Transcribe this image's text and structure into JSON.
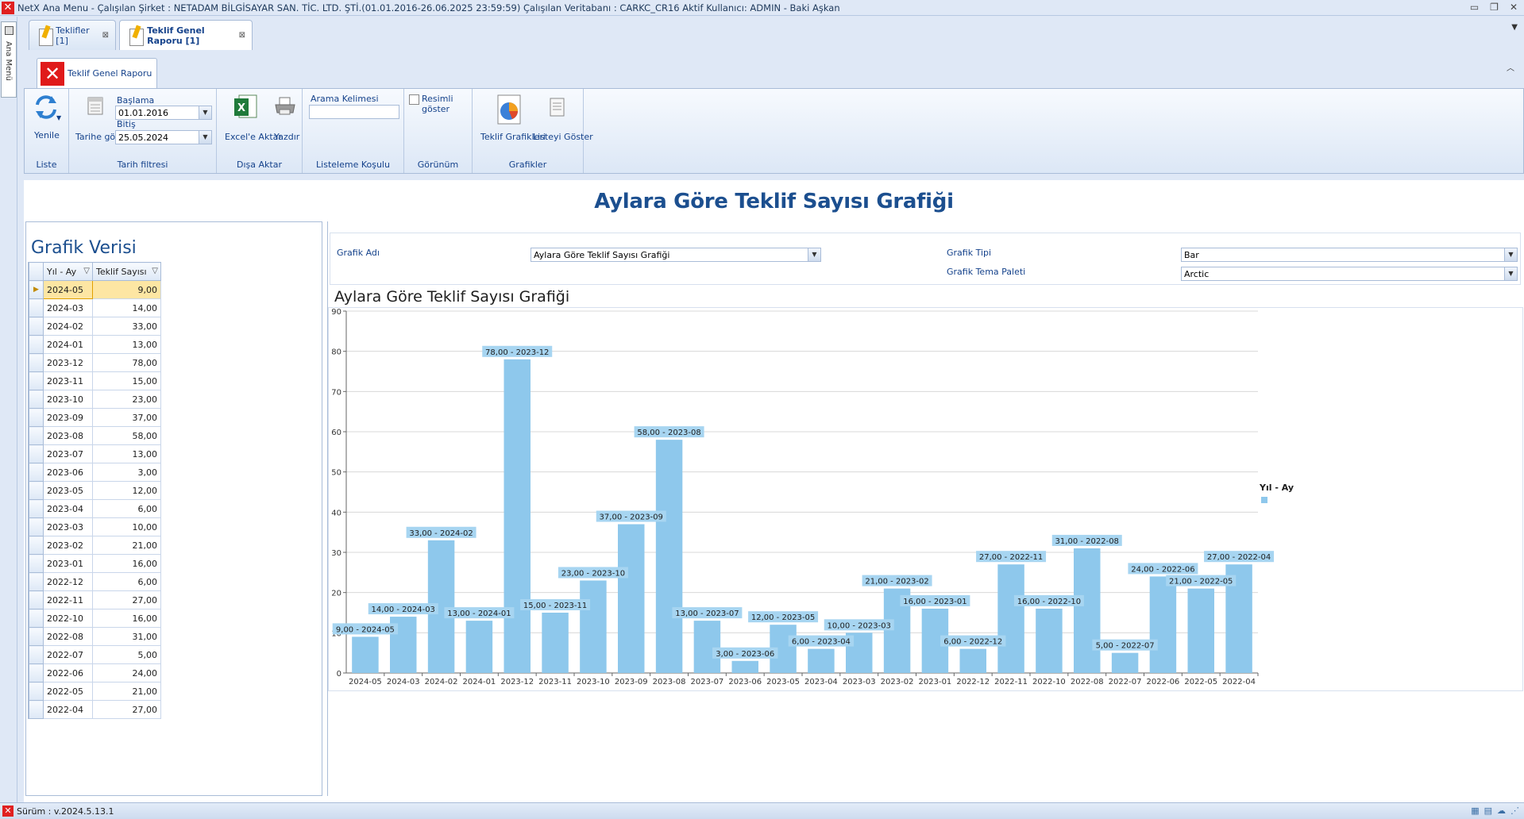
{
  "window": {
    "title": "NetX Ana Menu - Çalışılan Şirket : NETADAM BİLGİSAYAR SAN. TİC. LTD. ŞTİ.(01.01.2016-26.06.2025 23:59:59) Çalışılan Veritabanı : CARKC_CR16  Aktif Kullanıcı: ADMIN - Baki Aşkan",
    "minimize": "▭",
    "restore": "❐",
    "close": "✕"
  },
  "side_strip": {
    "label": "Ana Menü"
  },
  "doc_tabs": [
    {
      "label": "Teklifler [1]",
      "close": "⊠"
    },
    {
      "label": "Teklif Genel Raporu [1]",
      "close": "⊠"
    }
  ],
  "ribbon": {
    "tab_label": "Teklif Genel Raporu",
    "groups": {
      "liste": {
        "label": "Liste",
        "refresh_label": "Yenile"
      },
      "tarih": {
        "label": "Tarih filtresi",
        "by_date_label": "Tarihe göre",
        "start_label": "Başlama",
        "start_value": "01.01.2016",
        "end_label": "Bitiş",
        "end_value": "25.05.2024"
      },
      "disa_aktar": {
        "label": "Dışa Aktar",
        "excel_label": "Excel'e Aktar",
        "print_label": "Yazdır"
      },
      "listeleme": {
        "label": "Listeleme Koşulu",
        "search_label": "Arama Kelimesi",
        "search_value": ""
      },
      "gorunum": {
        "label": "Görünüm",
        "show_images_label": "Resimli göster"
      },
      "grafikler": {
        "label": "Grafikler",
        "charts_label": "Teklif Grafikleri",
        "show_list_label": "Listeyi Göster"
      }
    }
  },
  "report": {
    "title": "Aylara Göre Teklif Sayısı Grafiği"
  },
  "grid": {
    "title": "Grafik Verisi",
    "columns": [
      "Yıl - Ay",
      "Teklif Sayısı"
    ],
    "rows": [
      [
        "2024-05",
        "9,00"
      ],
      [
        "2024-03",
        "14,00"
      ],
      [
        "2024-02",
        "33,00"
      ],
      [
        "2024-01",
        "13,00"
      ],
      [
        "2023-12",
        "78,00"
      ],
      [
        "2023-11",
        "15,00"
      ],
      [
        "2023-10",
        "23,00"
      ],
      [
        "2023-09",
        "37,00"
      ],
      [
        "2023-08",
        "58,00"
      ],
      [
        "2023-07",
        "13,00"
      ],
      [
        "2023-06",
        "3,00"
      ],
      [
        "2023-05",
        "12,00"
      ],
      [
        "2023-04",
        "6,00"
      ],
      [
        "2023-03",
        "10,00"
      ],
      [
        "2023-02",
        "21,00"
      ],
      [
        "2023-01",
        "16,00"
      ],
      [
        "2022-12",
        "6,00"
      ],
      [
        "2022-11",
        "27,00"
      ],
      [
        "2022-10",
        "16,00"
      ],
      [
        "2022-08",
        "31,00"
      ],
      [
        "2022-07",
        "5,00"
      ],
      [
        "2022-06",
        "24,00"
      ],
      [
        "2022-05",
        "21,00"
      ],
      [
        "2022-04",
        "27,00"
      ]
    ]
  },
  "chart_options": {
    "name_label": "Grafik Adı",
    "name_value": "Aylara Göre Teklif Sayısı Grafiği",
    "type_label": "Grafik Tipi",
    "type_value": "Bar",
    "palette_label": "Grafik Tema Paleti",
    "palette_value": "Arctic"
  },
  "chart_data": {
    "type": "bar",
    "title": "Aylara Göre Teklif Sayısı Grafiği",
    "categories": [
      "2024-05",
      "2024-03",
      "2024-02",
      "2024-01",
      "2023-12",
      "2023-11",
      "2023-10",
      "2023-09",
      "2023-08",
      "2023-07",
      "2023-06",
      "2023-05",
      "2023-04",
      "2023-03",
      "2023-02",
      "2023-01",
      "2022-12",
      "2022-11",
      "2022-10",
      "2022-08",
      "2022-07",
      "2022-06",
      "2022-05",
      "2022-04"
    ],
    "values": [
      9,
      14,
      33,
      13,
      78,
      15,
      23,
      37,
      58,
      13,
      3,
      12,
      6,
      10,
      21,
      16,
      6,
      27,
      16,
      31,
      5,
      24,
      21,
      27
    ],
    "data_labels": [
      "9,00 - 2024-05",
      "14,00 - 2024-03",
      "33,00 - 2024-02",
      "13,00 - 2024-01",
      "78,00 - 2023-12",
      "15,00 - 2023-11",
      "23,00 - 2023-10",
      "37,00 - 2023-09",
      "58,00 - 2023-08",
      "13,00 - 2023-07",
      "3,00 - 2023-06",
      "12,00 - 2023-05",
      "6,00 - 2023-04",
      "10,00 - 2023-03",
      "21,00 - 2023-02",
      "16,00 - 2023-01",
      "6,00 - 2022-12",
      "27,00 - 2022-11",
      "16,00 - 2022-10",
      "31,00 - 2022-08",
      "5,00 - 2022-07",
      "24,00 - 2022-06",
      "21,00 - 2022-05",
      "27,00 - 2022-04"
    ],
    "ylim": [
      0,
      90
    ],
    "yticks": [
      0,
      10,
      20,
      30,
      40,
      50,
      60,
      70,
      80,
      90
    ],
    "grid": true,
    "legend": {
      "title": "Yıl - Ay",
      "placement": "right"
    },
    "bar_color": "#8ec8ec",
    "label_bg": "#a7d5f1"
  },
  "status": {
    "version": "Sürüm : v.2024.5.13.1"
  },
  "colors": {
    "accent": "#1c4f8f",
    "ribbon_text": "#15428b",
    "selection": "#fde6a3"
  }
}
